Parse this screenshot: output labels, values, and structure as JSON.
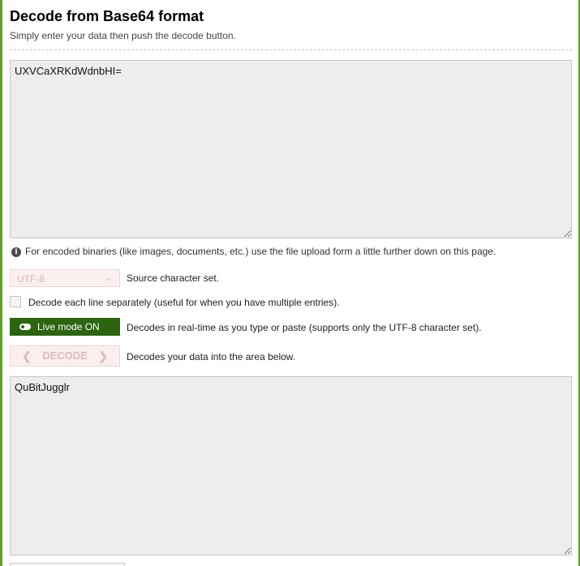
{
  "header": {
    "title": "Decode from Base64 format",
    "subtitle": "Simply enter your data then push the decode button."
  },
  "input": {
    "value": "UXVCaXRKdWdnbHI="
  },
  "info": {
    "icon": "info-icon",
    "text": "For encoded binaries (like images, documents, etc.) use the file upload form a little further down on this page."
  },
  "charset": {
    "selected": "UTF-8",
    "label": "Source character set."
  },
  "line_option": {
    "checked": false,
    "label": "Decode each line separately (useful for when you have multiple entries)."
  },
  "live_mode": {
    "label": "Live mode ON",
    "description": "Decodes in real-time as you type or paste (supports only the UTF-8 character set)."
  },
  "decode": {
    "label": "DECODE",
    "description": "Decodes your data into the area below."
  },
  "output": {
    "value": "QuBitJugglr"
  },
  "colors": {
    "frame": "#5aa619",
    "live_button": "#2b6510",
    "textarea_bg": "#ededed"
  }
}
